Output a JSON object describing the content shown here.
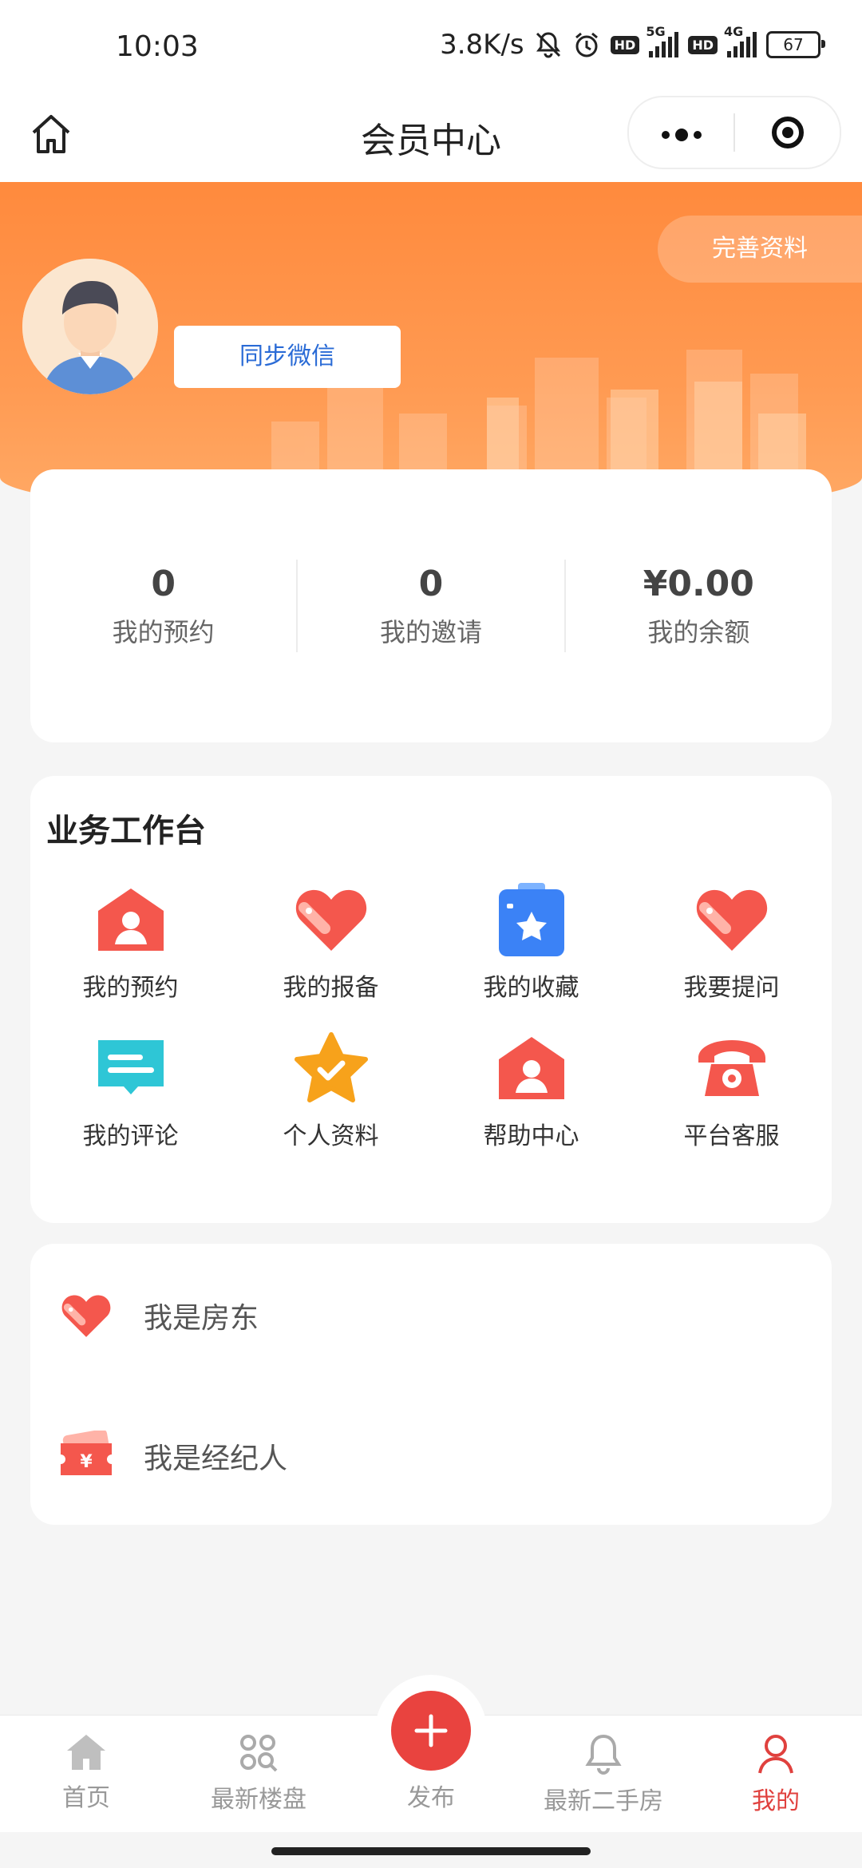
{
  "status_bar": {
    "time": "10:03",
    "speed": "3.8K/s",
    "net1": "5G",
    "net2": "4G",
    "hd": "HD",
    "battery": "67"
  },
  "nav": {
    "title": "会员中心"
  },
  "header": {
    "complete_label": "完善资料",
    "sync_label": "同步微信"
  },
  "stats": [
    {
      "value": "0",
      "label": "我的预约"
    },
    {
      "value": "0",
      "label": "我的邀请"
    },
    {
      "value": "¥0.00",
      "label": "我的余额"
    }
  ],
  "workbench": {
    "title": "业务工作台",
    "items": [
      {
        "label": "我的预约",
        "icon": "house-person-icon",
        "color": "#f4574d"
      },
      {
        "label": "我的报备",
        "icon": "heart-tag-icon",
        "color": "#f4574d"
      },
      {
        "label": "我的收藏",
        "icon": "clipboard-star-icon",
        "color": "#3b82f6"
      },
      {
        "label": "我要提问",
        "icon": "heart-tag-icon",
        "color": "#f4574d"
      },
      {
        "label": "我的评论",
        "icon": "chat-bubble-icon",
        "color": "#2ec6d6"
      },
      {
        "label": "个人资料",
        "icon": "star-check-icon",
        "color": "#f7a21b"
      },
      {
        "label": "帮助中心",
        "icon": "house-person-icon",
        "color": "#f4574d"
      },
      {
        "label": "平台客服",
        "icon": "telephone-icon",
        "color": "#f4574d"
      }
    ]
  },
  "roles": [
    {
      "label": "我是房东",
      "icon": "heart-tag-icon"
    },
    {
      "label": "我是经纪人",
      "icon": "ticket-yuan-icon"
    }
  ],
  "tabbar": {
    "items": [
      {
        "label": "首页",
        "icon": "home-icon"
      },
      {
        "label": "最新楼盘",
        "icon": "grid-search-icon"
      },
      {
        "label": "发布",
        "icon": "plus-icon"
      },
      {
        "label": "最新二手房",
        "icon": "bell-icon"
      },
      {
        "label": "我的",
        "icon": "person-icon"
      }
    ],
    "active": "我的",
    "active_color": "#e0413e"
  },
  "colors": {
    "header_orange": "#ff8a3d",
    "accent_red": "#e9433f",
    "link_blue": "#2a6bd6"
  }
}
